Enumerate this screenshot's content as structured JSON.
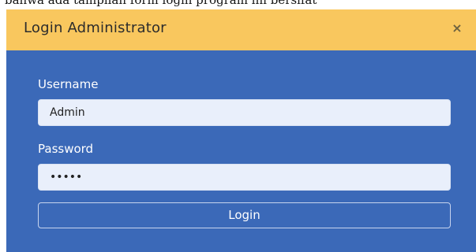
{
  "top_strip": {
    "text": "bahwa ada tampilan form login program ini bersifat"
  },
  "modal": {
    "title": "Login Administrator",
    "close_glyph": "×",
    "username": {
      "label": "Username",
      "value": "Admin"
    },
    "password": {
      "label": "Password",
      "value": "•••••"
    },
    "login_label": "Login"
  },
  "colors": {
    "header_bg": "#f9c75e",
    "body_bg": "#3b69b8",
    "input_bg": "#e9effb",
    "label_text": "#ffffff"
  },
  "icons": {
    "close": "close-icon"
  }
}
